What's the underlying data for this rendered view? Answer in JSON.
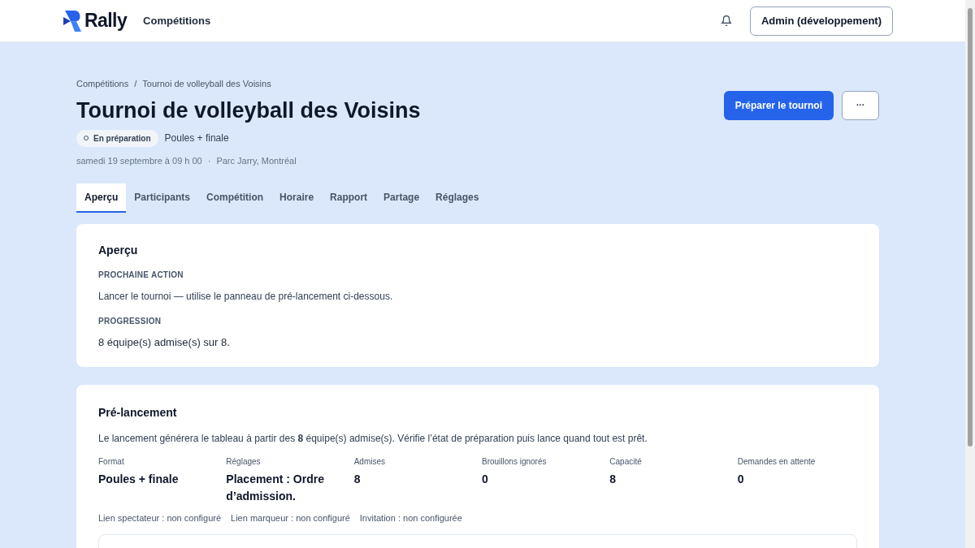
{
  "header": {
    "brand": "Rally",
    "nav": [
      "Compétitions"
    ],
    "account_button": "Admin (développement)"
  },
  "breadcrumb": [
    "Compétitions",
    "/",
    "Tournoi de volleyball des Voisins"
  ],
  "title": "Tournoi de volleyball des Voisins",
  "status_badge": "En préparation",
  "format": "Poules + finale",
  "date": "samedi 19 septembre à 09 h 00",
  "separator": "·",
  "location": "Parc Jarry, Montréal",
  "primary_button": "Préparer le tournoi",
  "more_button": "···",
  "tabs": [
    {
      "label": "Aperçu",
      "selected": true
    },
    {
      "label": "Participants",
      "selected": false
    },
    {
      "label": "Compétition",
      "selected": false
    },
    {
      "label": "Horaire",
      "selected": false
    },
    {
      "label": "Rapport",
      "selected": false
    },
    {
      "label": "Partage",
      "selected": false
    },
    {
      "label": "Réglages",
      "selected": false
    }
  ],
  "overview": {
    "title": "Aperçu",
    "next_action_label": "PROCHAINE ACTION",
    "next_action": "Lancer le tournoi — utilise le panneau de pré-lancement ci-dessous.",
    "progress_label": "PROGRESSION",
    "progress": "8 équipe(s) admise(s) sur 8."
  },
  "prelaunch": {
    "title": "Pré-lancement",
    "description": "Le lancement générera le tableau à partir des **8** équipe(s) admise(s). Vérifie l’état de préparation puis lance quand tout est prêt.",
    "stats": [
      {
        "label": "Format",
        "value": "Poules + finale"
      },
      {
        "label": "Réglages",
        "value": "Placement : Ordre d’admission."
      },
      {
        "label": "Admises",
        "value": "8"
      },
      {
        "label": "Brouillons ignorés",
        "value": "0"
      },
      {
        "label": "Capacité",
        "value": "8"
      },
      {
        "label": "Demandes en attente",
        "value": "0"
      }
    ],
    "links": [
      "Lien spectateur : non configuré",
      "Lien marqueur : non configuré",
      "Invitation : non configurée"
    ]
  }
}
